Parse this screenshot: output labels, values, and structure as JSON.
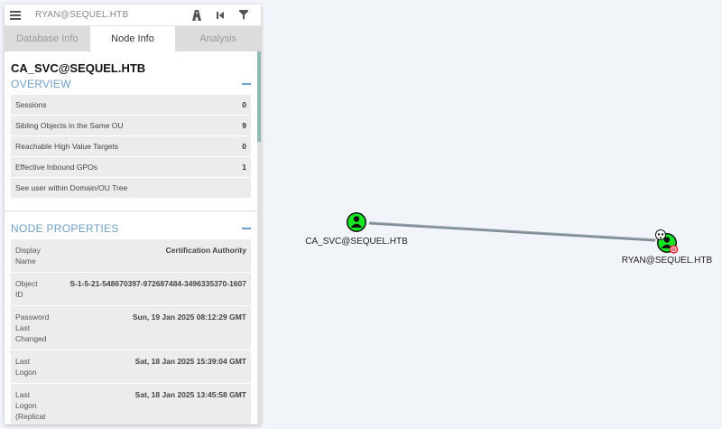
{
  "search": {
    "value": "RYAN@SEQUEL.HTB"
  },
  "toolbar": {
    "pathfinding_icon": "road-icon",
    "back_icon": "skip-back-icon",
    "filter_icon": "filter-icon"
  },
  "tabs": [
    {
      "label": "Database Info",
      "active": false
    },
    {
      "label": "Node Info",
      "active": true
    },
    {
      "label": "Analysis",
      "active": false
    }
  ],
  "node": {
    "name": "CA_SVC@SEQUEL.HTB"
  },
  "overview": {
    "title": "OVERVIEW",
    "rows": [
      {
        "label": "Sessions",
        "value": "0"
      },
      {
        "label": "Sibling Objects in the Same OU",
        "value": "9"
      },
      {
        "label": "Reachable High Value Targets",
        "value": "0"
      },
      {
        "label": "Effective Inbound GPOs",
        "value": "1"
      },
      {
        "label": "See user within Domain/OU Tree",
        "value": ""
      }
    ]
  },
  "properties": {
    "title": "NODE PROPERTIES",
    "rows": [
      {
        "key": "Display Name",
        "value": "Certification Authority"
      },
      {
        "key": "Object ID",
        "value": "S-1-5-21-548670397-972687484-3496335370-1607"
      },
      {
        "key": "Password Last Changed",
        "value": "Sun, 19 Jan 2025 08:12:29 GMT"
      },
      {
        "key": "Last Logon",
        "value": "Sat, 18 Jan 2025 15:39:04 GMT"
      },
      {
        "key": "Last Logon (Replicat",
        "value": "Sat, 18 Jan 2025 13:45:58 GMT"
      }
    ]
  },
  "graph": {
    "source_label": "CA_SVC@SEQUEL.HTB",
    "target_label": "RYAN@SEQUEL.HTB",
    "node_color": "#17e625",
    "edge_color": "#7f8c96"
  }
}
